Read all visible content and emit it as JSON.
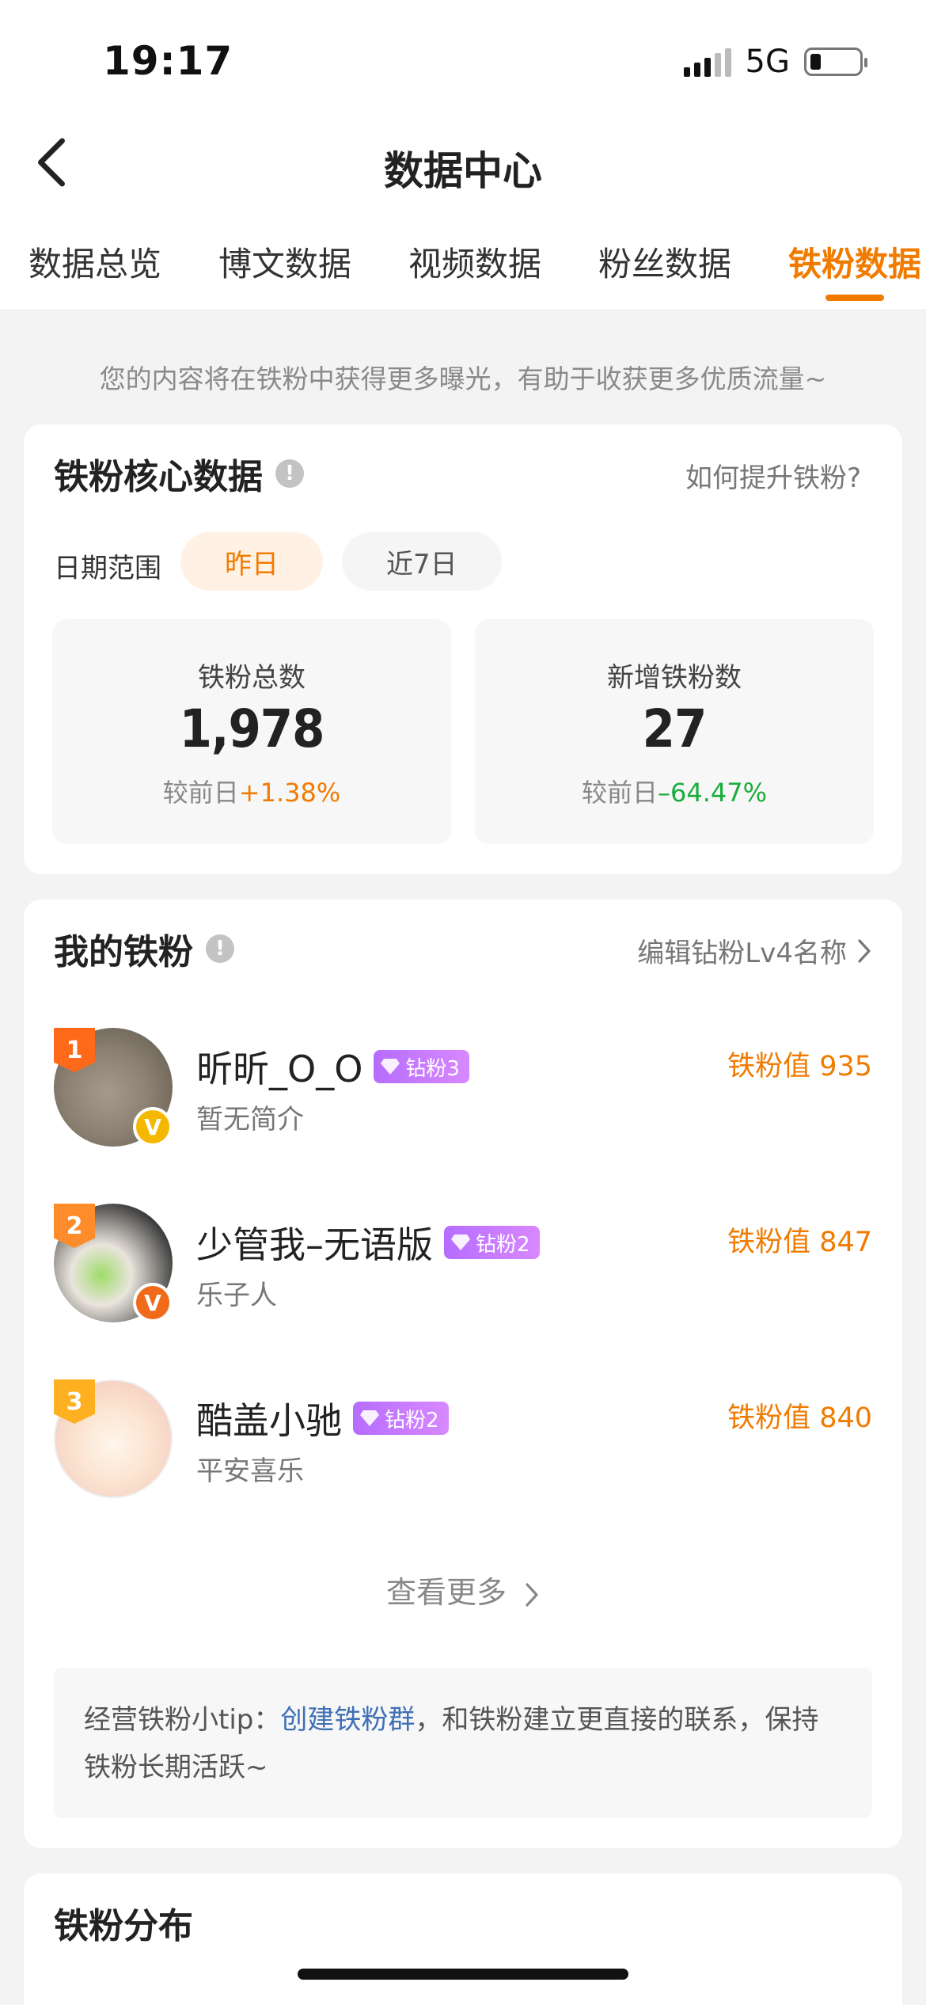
{
  "status": {
    "time": "19:17",
    "network": "5G"
  },
  "nav": {
    "title": "数据中心"
  },
  "tabs": [
    {
      "label": "数据总览"
    },
    {
      "label": "博文数据"
    },
    {
      "label": "视频数据"
    },
    {
      "label": "粉丝数据"
    },
    {
      "label": "铁粉数据"
    }
  ],
  "notice": "您的内容将在铁粉中获得更多曝光，有助于收获更多优质流量~",
  "core": {
    "title": "铁粉核心数据",
    "link": "如何提升铁粉?",
    "date_label": "日期范围",
    "date_options": [
      "昨日",
      "近7日"
    ],
    "stats": [
      {
        "label": "铁粉总数",
        "value": "1,978",
        "change_prefix": "较前日",
        "change": "+1.38%"
      },
      {
        "label": "新增铁粉数",
        "value": "27",
        "change_prefix": "较前日",
        "change": "–64.47%"
      }
    ]
  },
  "fans_section": {
    "title": "我的铁粉",
    "edit_link": "编辑钻粉Lv4名称",
    "fans": [
      {
        "rank": "1",
        "name": "昕昕_O_O",
        "badge": "钻粉3",
        "bio": "暂无简介",
        "score": "铁粉值 935",
        "rank_color": "#ff6a1a",
        "v_color": "#f5b800"
      },
      {
        "rank": "2",
        "name": "少管我–无语版",
        "badge": "钻粉2",
        "bio": "乐子人",
        "score": "铁粉值 847",
        "rank_color": "#ff8c2a",
        "v_color": "#f06a1a"
      },
      {
        "rank": "3",
        "name": "酷盖小驰",
        "badge": "钻粉2",
        "bio": "平安喜乐",
        "score": "铁粉值 840",
        "rank_color": "#ffb020",
        "v_color": ""
      }
    ],
    "more": "查看更多",
    "tip_prefix": "经营铁粉小tip：",
    "tip_link": "创建铁粉群",
    "tip_suffix": "，和铁粉建立更直接的联系，保持铁粉长期活跃~"
  },
  "distribution": {
    "title": "铁粉分布"
  },
  "colors": {
    "accent": "#f07b00",
    "positive": "#f07b00",
    "negative": "#1aad3c",
    "link": "#3f6fb5"
  }
}
